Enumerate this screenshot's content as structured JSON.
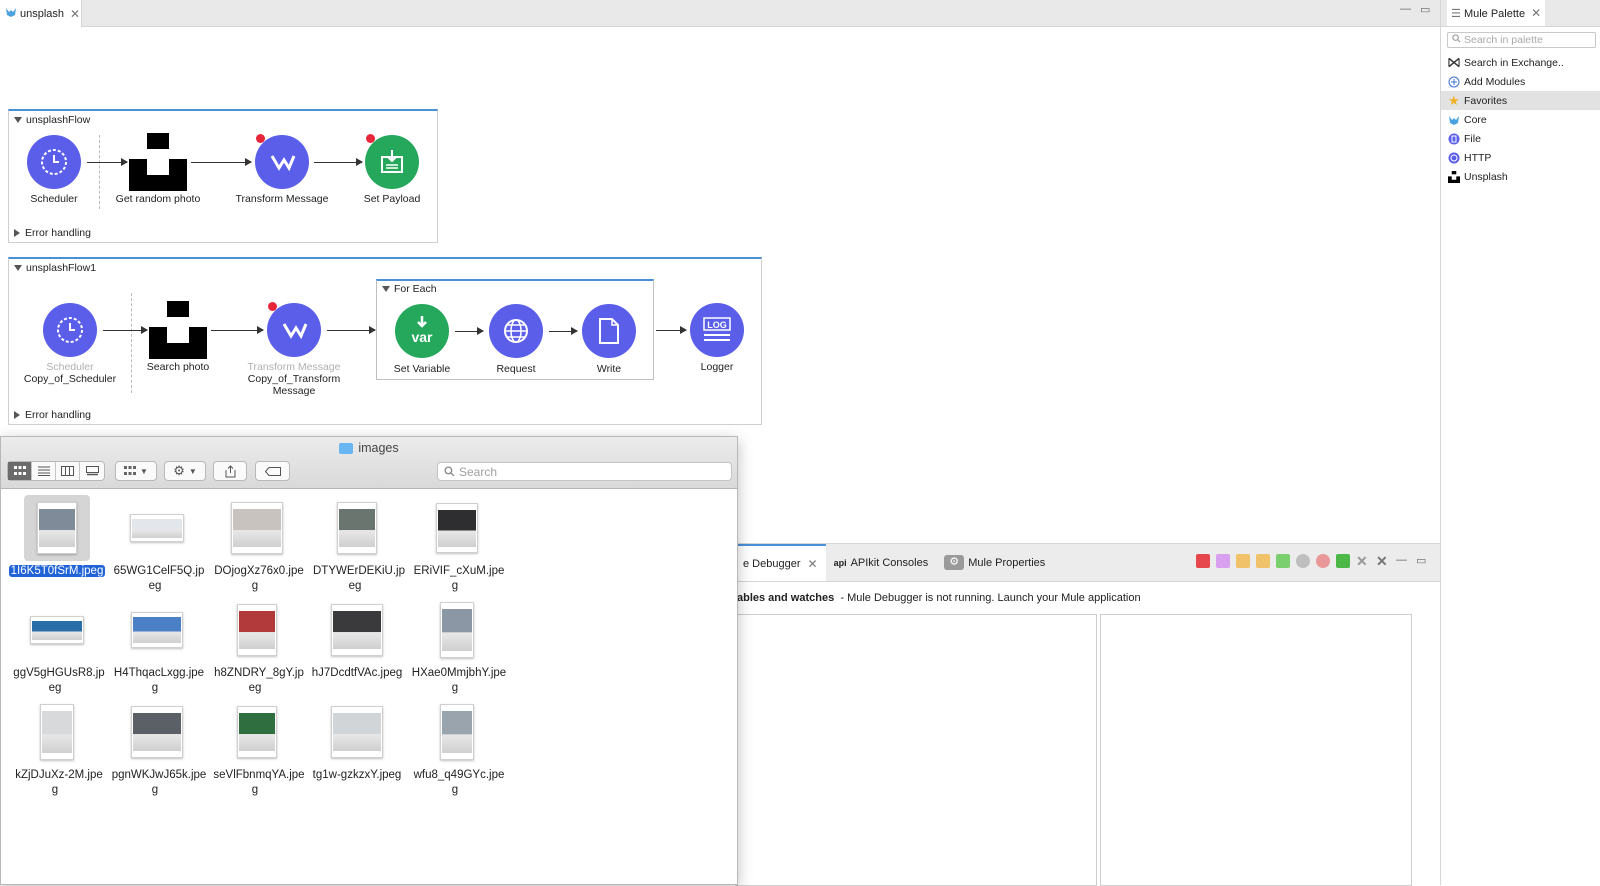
{
  "editor": {
    "tab_label": "unsplash"
  },
  "flows": [
    {
      "name": "unsplashFlow",
      "nodes": [
        {
          "label": "Scheduler"
        },
        {
          "label": "Get random photo"
        },
        {
          "label": "Transform Message"
        },
        {
          "label": "Set Payload"
        }
      ],
      "error_handling": "Error handling"
    },
    {
      "name": "unsplashFlow1",
      "nodes": [
        {
          "sub": "Scheduler",
          "label": "Copy_of_Scheduler"
        },
        {
          "label": "Search photo"
        },
        {
          "sub": "Transform Message",
          "label": "Copy_of_Transform Message"
        },
        {
          "label": "Set Variable"
        },
        {
          "label": "Request"
        },
        {
          "label": "Write"
        },
        {
          "label": "Logger"
        }
      ],
      "scope_title": "For Each",
      "error_handling": "Error handling",
      "icon_text": {
        "var": "var",
        "log": "LOG"
      }
    }
  ],
  "palette": {
    "tab_label": "Mule Palette",
    "search_placeholder": "Search in palette",
    "items": [
      {
        "label": "Search in Exchange..",
        "icon": "exchange-icon"
      },
      {
        "label": "Add Modules",
        "icon": "add-circle-icon"
      },
      {
        "label": "Favorites",
        "icon": "star-icon",
        "selected": true
      },
      {
        "label": "Core",
        "icon": "mule-icon"
      },
      {
        "label": "File",
        "icon": "file-module-icon"
      },
      {
        "label": "HTTP",
        "icon": "http-module-icon"
      },
      {
        "label": "Unsplash",
        "icon": "unsplash-icon"
      }
    ]
  },
  "bottom_panel": {
    "tabs": [
      {
        "label": "e Debugger",
        "active": true
      },
      {
        "label": "APIkit Consoles",
        "prefix": "api"
      },
      {
        "label": "Mule Properties"
      }
    ],
    "message_bold": "ables and watches",
    "message": "- Mule Debugger is not running. Launch your Mule application"
  },
  "finder": {
    "title": "images",
    "search_placeholder": "Search",
    "files": [
      {
        "name": "1I6K5T0fSrM.jpeg",
        "selected": true,
        "orient": "portrait",
        "color": "#7f8b99"
      },
      {
        "name": "65WG1CelF5Q.jpeg",
        "orient": "landscape-small",
        "color": "#e3e6ea"
      },
      {
        "name": "DOjogXz76x0.jpeg",
        "orient": "portrait-wide",
        "color": "#c9c3c0"
      },
      {
        "name": "DTYWErDEKiU.jpeg",
        "orient": "portrait",
        "color": "#6b7570"
      },
      {
        "name": "ERiVIF_cXuM.jpeg",
        "orient": "portrait-short",
        "color": "#2e2e30"
      },
      {
        "name": "ggV5gHGUsR8.jpeg",
        "orient": "landscape-small",
        "color": "#2a6ea8"
      },
      {
        "name": "H4ThqacLxgg.jpeg",
        "orient": "landscape",
        "color": "#4b7fc6"
      },
      {
        "name": "h8ZNDRY_8gY.jpeg",
        "orient": "portrait",
        "color": "#b33a3a"
      },
      {
        "name": "hJ7DcdtfVAc.jpeg",
        "orient": "portrait-wide",
        "color": "#3a3a3c"
      },
      {
        "name": "HXae0MmjbhY.jpeg",
        "orient": "portrait-narrow",
        "color": "#8c97a6"
      },
      {
        "name": "kZjDJuXz-2M.jpeg",
        "orient": "portrait-narrow",
        "color": "#d7d9db"
      },
      {
        "name": "pgnWKJwJ65k.jpeg",
        "orient": "portrait-wide",
        "color": "#5a6066"
      },
      {
        "name": "seVlFbnmqYA.jpeg",
        "orient": "portrait",
        "color": "#2f6f3f"
      },
      {
        "name": "tg1w-gzkzxY.jpeg",
        "orient": "portrait-wide",
        "color": "#d2d5d8"
      },
      {
        "name": "wfu8_q49GYc.jpeg",
        "orient": "portrait-narrow",
        "color": "#9aa4ad"
      }
    ]
  }
}
